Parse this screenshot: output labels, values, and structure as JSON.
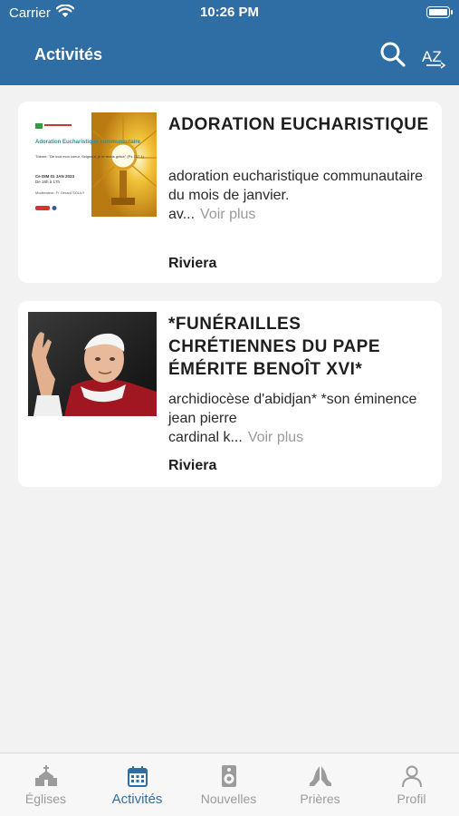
{
  "status_bar": {
    "carrier": "Carrier",
    "time": "10:26 PM"
  },
  "header": {
    "title": "Activités",
    "search_icon": "search-icon",
    "sort_icon": "sort-az-icon",
    "sort_label": "AZ"
  },
  "activities": [
    {
      "title": "ADORATION EUCHARISTIQUE",
      "description": "adoration eucharistique communautaire du mois de janvier.",
      "desc_tail": "av...",
      "more_label": "Voir plus",
      "location": "Riviera",
      "poster": {
        "heading": "Adoration Eucharistique communautaire",
        "theme": "Thème: \"De tout mon coeur, Seigneur, je te rends grâce\" (Ps 137,1)",
        "date": "Ce DIM 01 JAN 2023",
        "time": "De 16h à 17h",
        "moderator": "Modérateur: Fr Gérard SOULY"
      }
    },
    {
      "title": "*FUNÉRAILLES CHRÉTIENNES DU PAPE ÉMÉRITE BENOÎT XVI*",
      "description": "archidiocèse d'abidjan* *son éminence jean pierre",
      "desc_tail": "cardinal k...",
      "more_label": "Voir plus",
      "location": "Riviera"
    }
  ],
  "tabs": [
    {
      "label": "Églises",
      "icon": "church-icon",
      "active": false
    },
    {
      "label": "Activités",
      "icon": "calendar-icon",
      "active": true
    },
    {
      "label": "Nouvelles",
      "icon": "speaker-icon",
      "active": false
    },
    {
      "label": "Prières",
      "icon": "praying-hands-icon",
      "active": false
    },
    {
      "label": "Profil",
      "icon": "person-icon",
      "active": false
    }
  ],
  "colors": {
    "header": "#2f6ea5",
    "active_tab": "#2f6ea5",
    "inactive_tab": "#9b9b9b",
    "background": "#f2f2f2"
  }
}
